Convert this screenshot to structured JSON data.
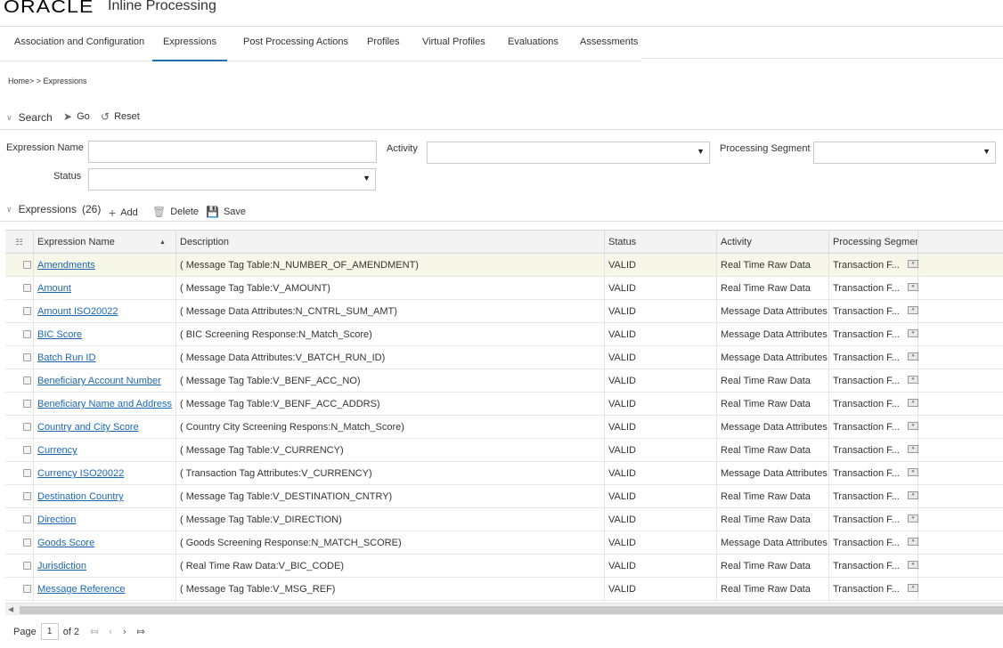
{
  "header": {
    "logo": "ORACLE",
    "app_title": "Inline Processing"
  },
  "tabs": [
    {
      "label": "Association and Configuration",
      "active": false
    },
    {
      "label": "Expressions",
      "active": true
    },
    {
      "label": "Post Processing Actions",
      "active": false
    },
    {
      "label": "Profiles",
      "active": false
    },
    {
      "label": "Virtual Profiles",
      "active": false
    },
    {
      "label": "Evaluations",
      "active": false
    },
    {
      "label": "Assessments",
      "active": false
    }
  ],
  "breadcrumb": "Home> > Expressions",
  "search": {
    "title": "Search",
    "go_label": "Go",
    "reset_label": "Reset",
    "fields": {
      "expression_name_label": "Expression Name",
      "expression_name_value": "",
      "activity_label": "Activity",
      "activity_value": "",
      "processing_segment_label": "Processing Segment",
      "processing_segment_value": "",
      "status_label": "Status",
      "status_value": ""
    }
  },
  "expressions": {
    "title": "Expressions",
    "count": "(26)",
    "add_label": "Add",
    "delete_label": "Delete",
    "save_label": "Save",
    "columns": [
      "Expression Name",
      "Description",
      "Status",
      "Activity",
      "Processing Segment"
    ],
    "rows": [
      {
        "name": "Amendments",
        "description": "( Message Tag Table:N_NUMBER_OF_AMENDMENT)",
        "status": "VALID",
        "activity": "Real Time Raw Data",
        "segment": "Transaction F..."
      },
      {
        "name": "Amount",
        "description": "( Message Tag Table:V_AMOUNT)",
        "status": "VALID",
        "activity": "Real Time Raw Data",
        "segment": "Transaction F..."
      },
      {
        "name": "Amount ISO20022",
        "description": "( Message Data Attributes:N_CNTRL_SUM_AMT)",
        "status": "VALID",
        "activity": "Message Data Attributes",
        "segment": "Transaction F..."
      },
      {
        "name": "BIC Score",
        "description": "( BIC Screening Response:N_Match_Score)",
        "status": "VALID",
        "activity": "Message Data Attributes",
        "segment": "Transaction F..."
      },
      {
        "name": "Batch Run ID",
        "description": "( Message Data Attributes:V_BATCH_RUN_ID)",
        "status": "VALID",
        "activity": "Message Data Attributes",
        "segment": "Transaction F..."
      },
      {
        "name": "Beneficiary Account Number",
        "description": "( Message Tag Table:V_BENF_ACC_NO)",
        "status": "VALID",
        "activity": "Real Time Raw Data",
        "segment": "Transaction F..."
      },
      {
        "name": "Beneficiary Name and Address",
        "description": "( Message Tag Table:V_BENF_ACC_ADDRS)",
        "status": "VALID",
        "activity": "Real Time Raw Data",
        "segment": "Transaction F..."
      },
      {
        "name": "Country and City Score",
        "description": "( Country City Screening Respons:N_Match_Score)",
        "status": "VALID",
        "activity": "Message Data Attributes",
        "segment": "Transaction F..."
      },
      {
        "name": "Currency",
        "description": "( Message Tag Table:V_CURRENCY)",
        "status": "VALID",
        "activity": "Real Time Raw Data",
        "segment": "Transaction F..."
      },
      {
        "name": "Currency ISO20022",
        "description": "( Transaction Tag Attributes:V_CURRENCY)",
        "status": "VALID",
        "activity": "Message Data Attributes",
        "segment": "Transaction F..."
      },
      {
        "name": "Destination Country",
        "description": "( Message Tag Table:V_DESTINATION_CNTRY)",
        "status": "VALID",
        "activity": "Real Time Raw Data",
        "segment": "Transaction F..."
      },
      {
        "name": "Direction",
        "description": "( Message Tag Table:V_DIRECTION)",
        "status": "VALID",
        "activity": "Real Time Raw Data",
        "segment": "Transaction F..."
      },
      {
        "name": "Goods Score",
        "description": "( Goods Screening Response:N_MATCH_SCORE)",
        "status": "VALID",
        "activity": "Message Data Attributes",
        "segment": "Transaction F..."
      },
      {
        "name": "Jurisdiction",
        "description": "( Real Time Raw Data:V_BIC_CODE)",
        "status": "VALID",
        "activity": "Real Time Raw Data",
        "segment": "Transaction F..."
      },
      {
        "name": "Message Reference",
        "description": "( Message Tag Table:V_MSG_REF)",
        "status": "VALID",
        "activity": "Real Time Raw Data",
        "segment": "Transaction F..."
      }
    ]
  },
  "pager": {
    "page_label": "Page",
    "current_page": "1",
    "of_label": "of 2"
  },
  "colors": {
    "link": "#1b67b3",
    "active_tab": "#1f6fb2",
    "selected_row": "#f7f7e9"
  }
}
